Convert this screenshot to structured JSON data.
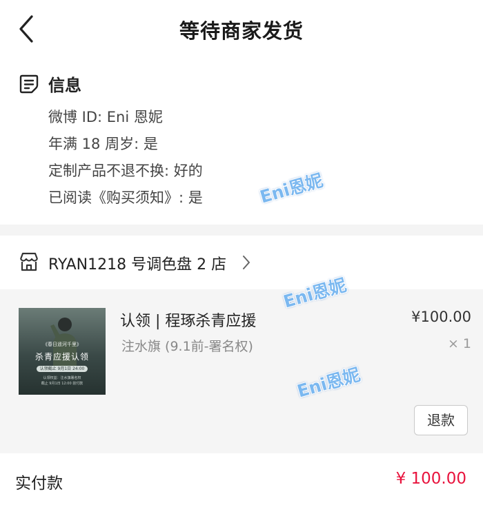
{
  "header": {
    "title": "等待商家发货",
    "back_icon": "chevron-left-icon"
  },
  "info": {
    "icon": "note-icon",
    "title": "信息",
    "lines": [
      "微博 ID: Eni 恩妮",
      "年满 18 周岁: 是",
      "定制产品不退不换: 好的",
      "已阅读《购买须知》: 是"
    ]
  },
  "shop": {
    "icon": "store-icon",
    "name": "RYAN1218 号调色盘 2 店",
    "chevron_icon": "chevron-right-icon"
  },
  "product": {
    "title": "认领 | 程琢杀青应援",
    "spec": "注水旗 (9.1前-署名权)",
    "price": "¥100.00",
    "quantity": "× 1",
    "refund_label": "退款",
    "thumbnail": {
      "tag": "《春日遥河千里》",
      "main": "杀青应援认领",
      "pill": "认领截止  9月1日 24:00",
      "small1": "认领权益：注水旗署名权",
      "small2": "截止 9月1日 12:00 前付款"
    }
  },
  "total": {
    "label": "实付款",
    "amount": "¥ 100.00"
  },
  "watermarks": [
    "Eni恩妮",
    "Eni恩妮",
    "Eni恩妮"
  ],
  "colors": {
    "price_red": "#e8133d",
    "watermark_blue": "#7bb8f0",
    "section_gray": "#f5f5f5"
  }
}
